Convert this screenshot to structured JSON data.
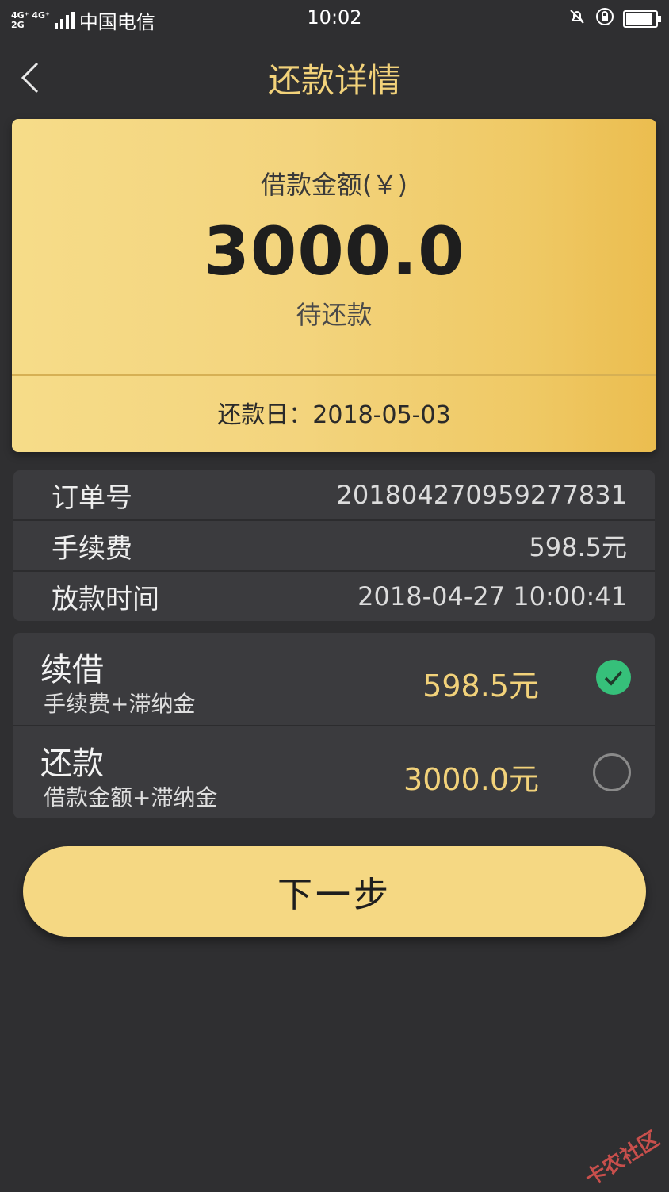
{
  "status_bar": {
    "network_top": "4G⁺ 4G⁺",
    "network_bottom": "2G",
    "carrier": "中国电信",
    "time": "10:02",
    "battery_level": 0.9
  },
  "nav": {
    "title": "还款详情"
  },
  "card": {
    "label": "借款金额(￥)",
    "amount": "3000.0",
    "status": "待还款",
    "due": "还款日：2018-05-03"
  },
  "info": {
    "rows": [
      {
        "key": "订单号",
        "value": "201804270959277831"
      },
      {
        "key": "手续费",
        "value": "598.5元"
      },
      {
        "key": "放款时间",
        "value": "2018-04-27 10:00:41"
      }
    ]
  },
  "options": [
    {
      "title": "续借",
      "subtitle": "手续费+滞纳金",
      "amount": "598.5元",
      "selected": true
    },
    {
      "title": "还款",
      "subtitle": "借款金额+滞纳金",
      "amount": "3000.0元",
      "selected": false
    }
  ],
  "next_button": {
    "label": "下一步"
  },
  "watermark": {
    "text": "卡农社区"
  },
  "colors": {
    "background": "#2f2f31",
    "accent": "#f2d27a",
    "card_gold": "#f3d47d",
    "check_green": "#36c07a"
  }
}
